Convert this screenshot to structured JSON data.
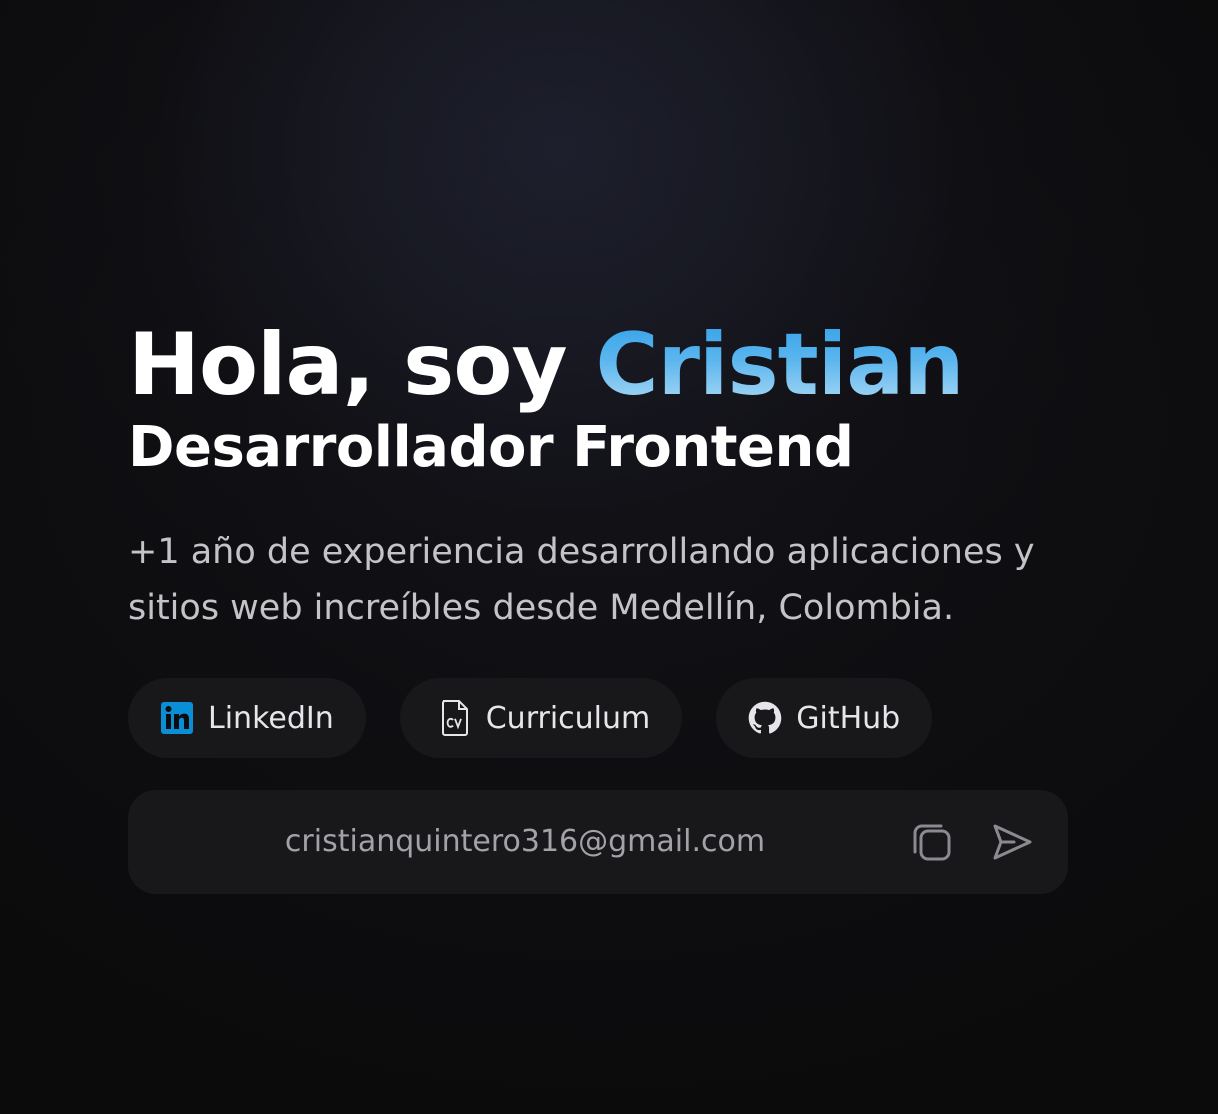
{
  "hero": {
    "greeting": "Hola, soy ",
    "name": "Cristian",
    "role": "Desarrollador Frontend",
    "description": "+1 año de experiencia desarrollando aplicaciones y sitios web increíbles desde Medellín, Colombia."
  },
  "links": [
    {
      "label": "LinkedIn",
      "icon": "linkedin-icon",
      "color": "#0a8fd6"
    },
    {
      "label": "Curriculum",
      "icon": "cv-document-icon"
    },
    {
      "label": "GitHub",
      "icon": "github-icon"
    }
  ],
  "contact": {
    "email": "cristianquintero316@gmail.com",
    "copy_icon": "copy-icon",
    "send_icon": "send-icon"
  },
  "colors": {
    "accent_top": "#2f9ee8",
    "accent_bottom": "#b9def6",
    "background": "#0b0b0c",
    "pill_background": "#18181b"
  }
}
